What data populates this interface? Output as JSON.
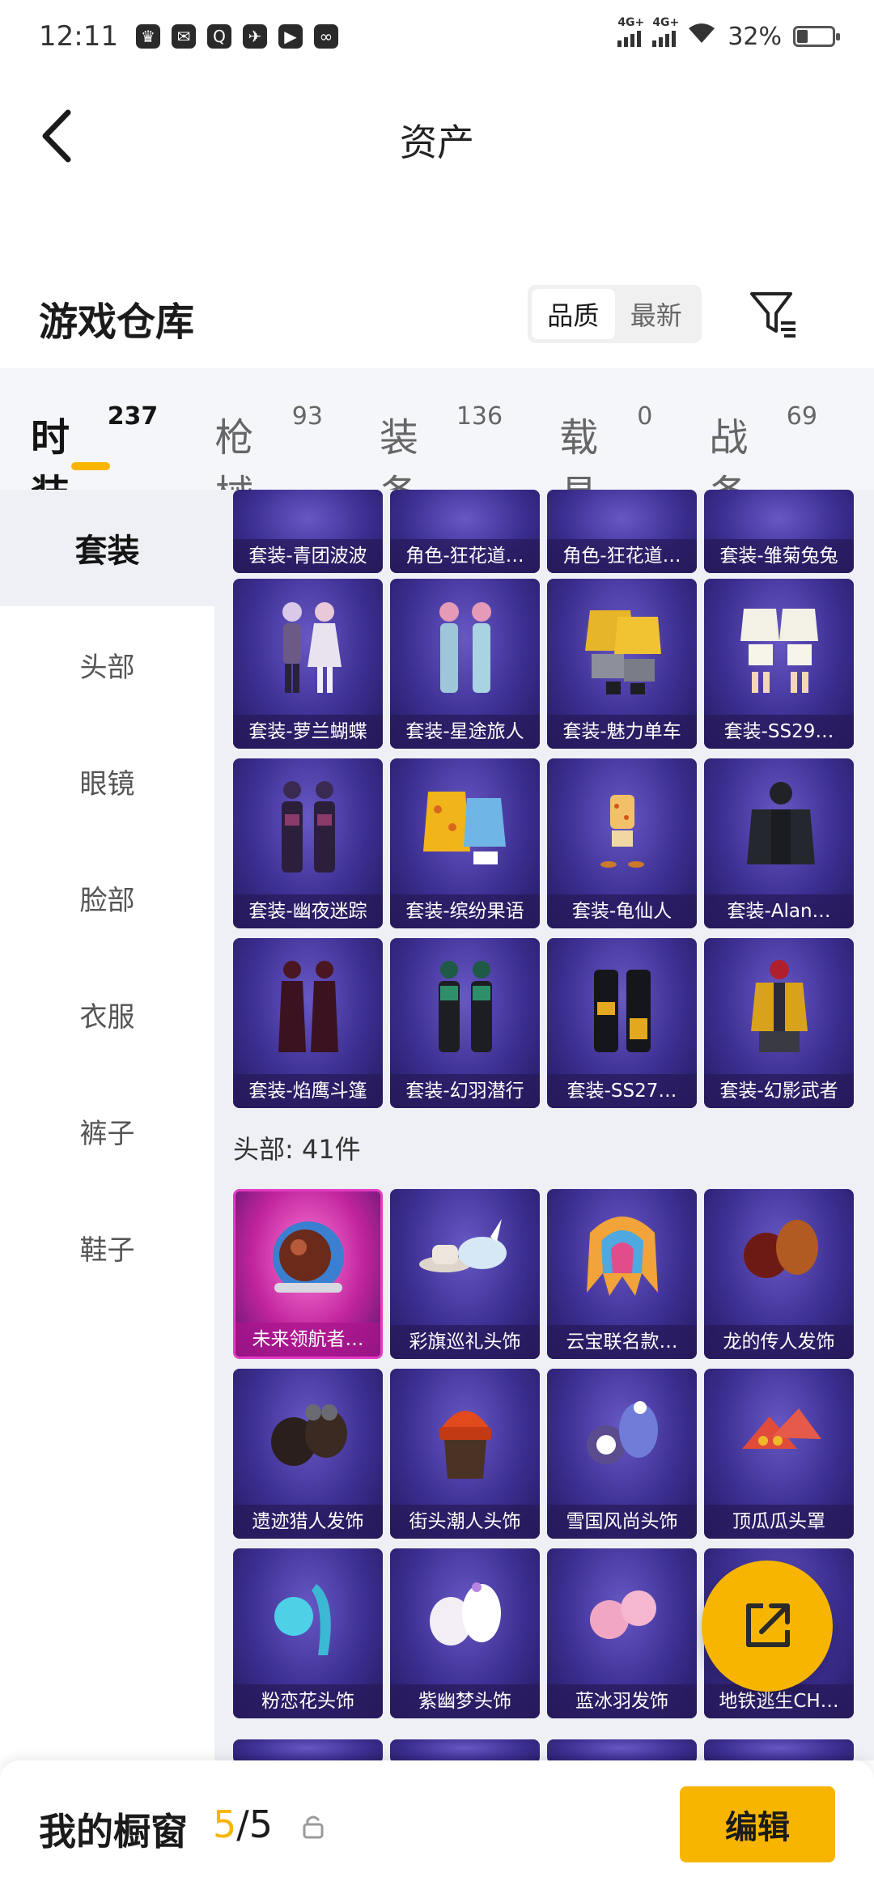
{
  "status_bar": {
    "time": "12:11",
    "network_1": "4G+",
    "network_2": "4G+",
    "battery_percent": "32%",
    "battery_level": 0.32
  },
  "header": {
    "title": "资产"
  },
  "warehouse": {
    "title": "游戏仓库",
    "sort_options": [
      "品质",
      "最新"
    ],
    "sort_selected": "品质"
  },
  "tabs": [
    {
      "label": "时装",
      "count": "237"
    },
    {
      "label": "枪械",
      "count": "93"
    },
    {
      "label": "装备",
      "count": "136"
    },
    {
      "label": "载具",
      "count": "0"
    },
    {
      "label": "战备",
      "count": "69"
    }
  ],
  "sidebar": {
    "items": [
      "套装",
      "头部",
      "眼镜",
      "脸部",
      "衣服",
      "裤子",
      "鞋子"
    ]
  },
  "suits": {
    "partial_row": [
      "套装-青团波波",
      "角色-狂花道…",
      "角色-狂花道…",
      "套装-雏菊兔兔"
    ],
    "rows": [
      [
        "套装-萝兰蝴蝶",
        "套装-星途旅人",
        "套装-魅力单车",
        "套装-SS29…"
      ],
      [
        "套装-幽夜迷踪",
        "套装-缤纷果语",
        "套装-龟仙人",
        "套装-Alan…"
      ],
      [
        "套装-焰鹰斗篷",
        "套装-幻羽潜行",
        "套装-SS27…",
        "套装-幻影武者"
      ]
    ]
  },
  "head_section": {
    "label": "头部: 41件",
    "rows": [
      [
        "未来领航者…",
        "彩旗巡礼头饰",
        "云宝联名款…",
        "龙的传人发饰"
      ],
      [
        "遗迹猎人发饰",
        "街头潮人头饰",
        "雪国风尚头饰",
        "顶瓜瓜头罩"
      ],
      [
        "粉恋花头饰",
        "紫幽梦头饰",
        "蓝冰羽发饰",
        "地铁逃生CH…"
      ]
    ]
  },
  "bottom_bar": {
    "label": "我的橱窗",
    "current": "5",
    "separator": "/",
    "total": "5",
    "edit_label": "编辑"
  },
  "colors": {
    "accent": "#f7b500",
    "card_purple": "#3c2f92",
    "card_gold_pink": "#c0249c"
  },
  "icons": {
    "back": "chevron-left-icon",
    "filter": "filter-icon",
    "fab": "share-icon",
    "lock": "lock-icon"
  }
}
